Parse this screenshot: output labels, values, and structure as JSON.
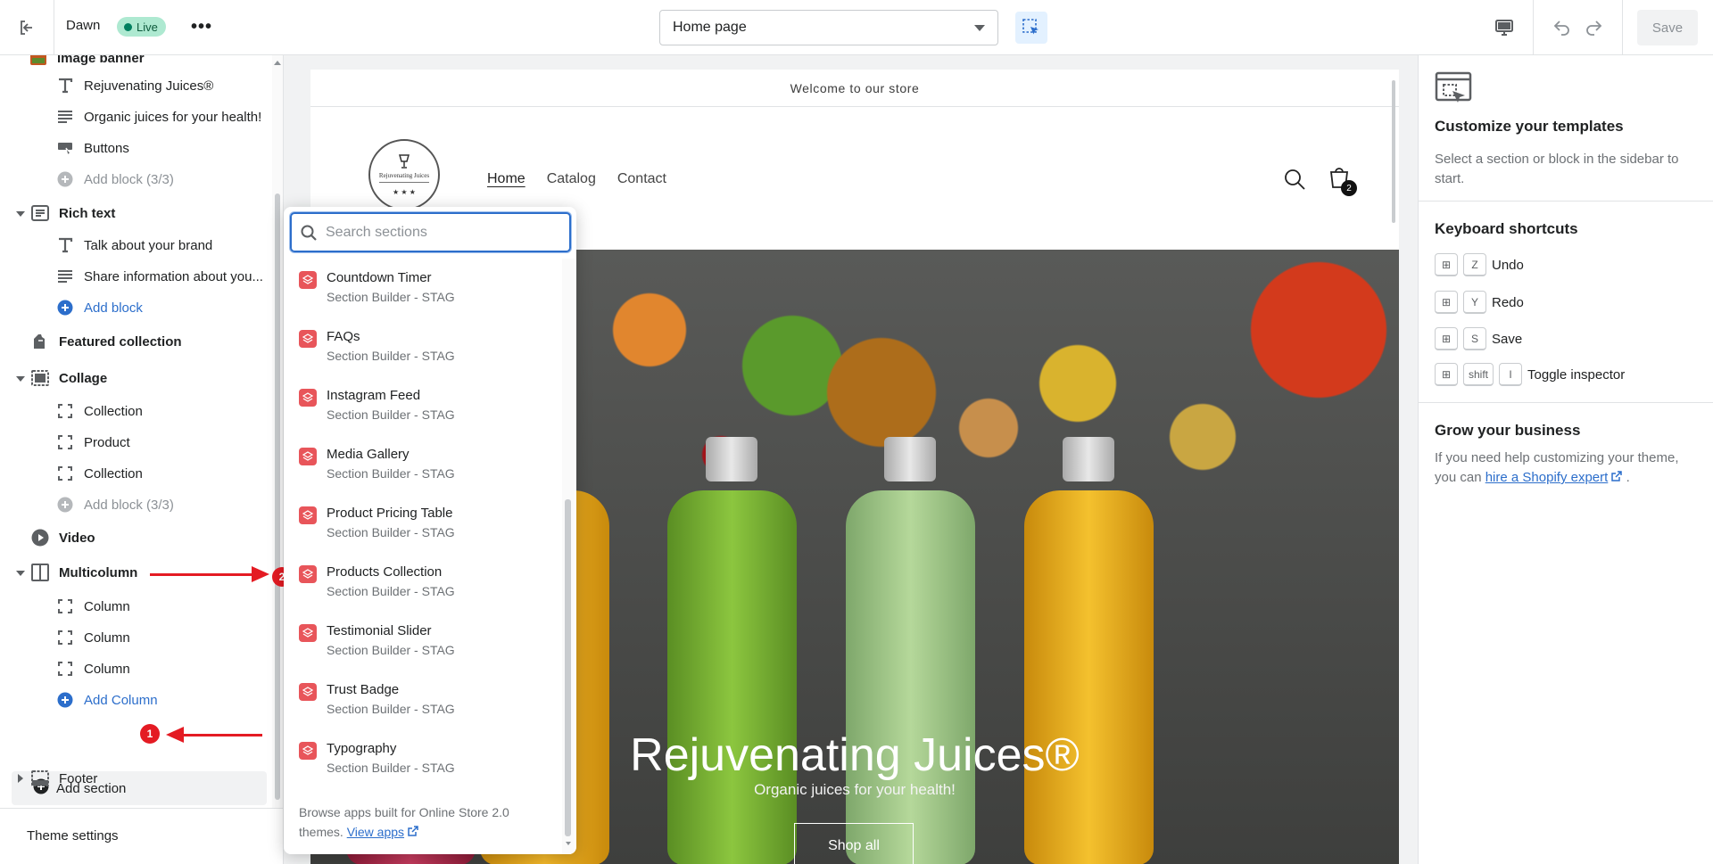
{
  "topbar": {
    "theme_name": "Dawn",
    "status_badge": "Live",
    "page_select": "Home page",
    "save_label": "Save"
  },
  "sidebar": {
    "items": [
      {
        "label": "Image banner"
      },
      {
        "label": "Rejuvenating Juices®"
      },
      {
        "label": "Organic juices for your health!"
      },
      {
        "label": "Buttons"
      },
      {
        "label": "Add block (3/3)"
      },
      {
        "label": "Rich text"
      },
      {
        "label": "Talk about your brand"
      },
      {
        "label": "Share information about you..."
      },
      {
        "label": "Add block"
      },
      {
        "label": "Featured collection"
      },
      {
        "label": "Collage"
      },
      {
        "label": "Collection"
      },
      {
        "label": "Product"
      },
      {
        "label": "Collection"
      },
      {
        "label": "Add block (3/3)"
      },
      {
        "label": "Video"
      },
      {
        "label": "Multicolumn"
      },
      {
        "label": "Column"
      },
      {
        "label": "Column"
      },
      {
        "label": "Column"
      },
      {
        "label": "Add Column"
      },
      {
        "label": "Add section"
      },
      {
        "label": "Footer"
      }
    ],
    "theme_settings": "Theme settings"
  },
  "annotations": {
    "badge1": "1",
    "badge2": "2"
  },
  "picker": {
    "search_placeholder": "Search sections",
    "items": [
      {
        "title": "Countdown Timer",
        "subtitle": "Section Builder - STAG"
      },
      {
        "title": "FAQs",
        "subtitle": "Section Builder - STAG"
      },
      {
        "title": "Instagram Feed",
        "subtitle": "Section Builder - STAG"
      },
      {
        "title": "Media Gallery",
        "subtitle": "Section Builder - STAG"
      },
      {
        "title": "Product Pricing Table",
        "subtitle": "Section Builder - STAG"
      },
      {
        "title": "Products Collection",
        "subtitle": "Section Builder - STAG"
      },
      {
        "title": "Testimonial Slider",
        "subtitle": "Section Builder - STAG"
      },
      {
        "title": "Trust Badge",
        "subtitle": "Section Builder - STAG"
      },
      {
        "title": "Typography",
        "subtitle": "Section Builder - STAG"
      }
    ],
    "footer_text": "Browse apps built for Online Store 2.0 themes.",
    "footer_link": "View apps"
  },
  "preview": {
    "announcement": "Welcome to our store",
    "logo_text": "Rejuvenating Juices",
    "nav": [
      "Home",
      "Catalog",
      "Contact"
    ],
    "cart_count": "2",
    "hero_title": "Rejuvenating Juices®",
    "hero_subtitle": "Organic juices for your health!",
    "hero_button": "Shop all"
  },
  "right_panel": {
    "customize_title": "Customize your templates",
    "customize_text": "Select a section or block in the sidebar to start.",
    "shortcuts_title": "Keyboard shortcuts",
    "shortcuts": [
      {
        "keys": [
          "Z"
        ],
        "label": "Undo"
      },
      {
        "keys": [
          "Y"
        ],
        "label": "Redo"
      },
      {
        "keys": [
          "S"
        ],
        "label": "Save"
      },
      {
        "keys": [
          "shift",
          "I"
        ],
        "label": "Toggle inspector"
      }
    ],
    "grow_title": "Grow your business",
    "grow_text": "If you need help customizing your theme, you can",
    "grow_link": "hire a Shopify expert",
    "grow_end": "."
  },
  "colors": {
    "accent": "#2c6ecb",
    "live_bg": "#aee9d1",
    "annotation": "#e41b23",
    "app_icon": "#e8555a"
  }
}
